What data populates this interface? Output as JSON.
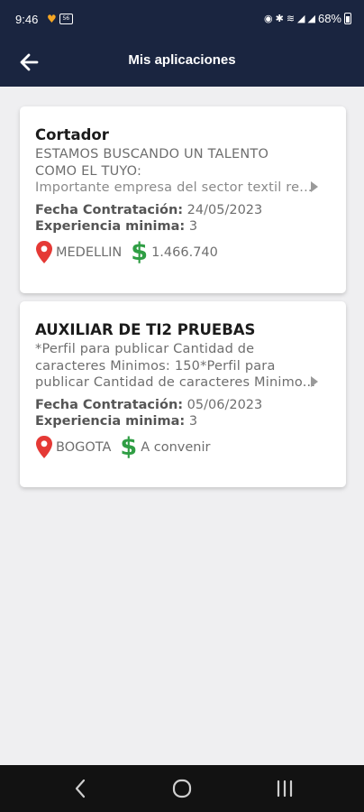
{
  "status_bar": {
    "time": "9:46",
    "battery_percent": "68%",
    "notification_badge": "56"
  },
  "app_bar": {
    "title": "Mis aplicaciones",
    "back_icon": "arrow-left-icon"
  },
  "labels": {
    "hire_date": "Fecha Contratación:",
    "experience": "Experiencia minima:"
  },
  "jobs": [
    {
      "title": "Cortador",
      "description_lines": [
        "ESTAMOS BUSCANDO UN TALENTO",
        "COMO EL TUYO:",
        "Importante empresa del sector textil re..."
      ],
      "hire_date": "24/05/2023",
      "min_experience": "3",
      "location": "MEDELLIN",
      "salary": "1.466.740"
    },
    {
      "title": "AUXILIAR DE TI2 PRUEBAS",
      "description_lines": [
        "*Perfil para publicar Cantidad de",
        "caracteres Minimos: 150*Perfil para",
        "publicar Cantidad de caracteres Minimo..."
      ],
      "hire_date": "05/06/2023",
      "min_experience": "3",
      "location": "BOGOTA",
      "salary": "A convenir"
    }
  ],
  "icons": {
    "location": "map-pin-icon",
    "salary": "dollar-icon",
    "open": "chevron-right-icon"
  },
  "colors": {
    "header": "#1a2540",
    "pin": "#e53935",
    "dollar": "#2f9e44"
  }
}
